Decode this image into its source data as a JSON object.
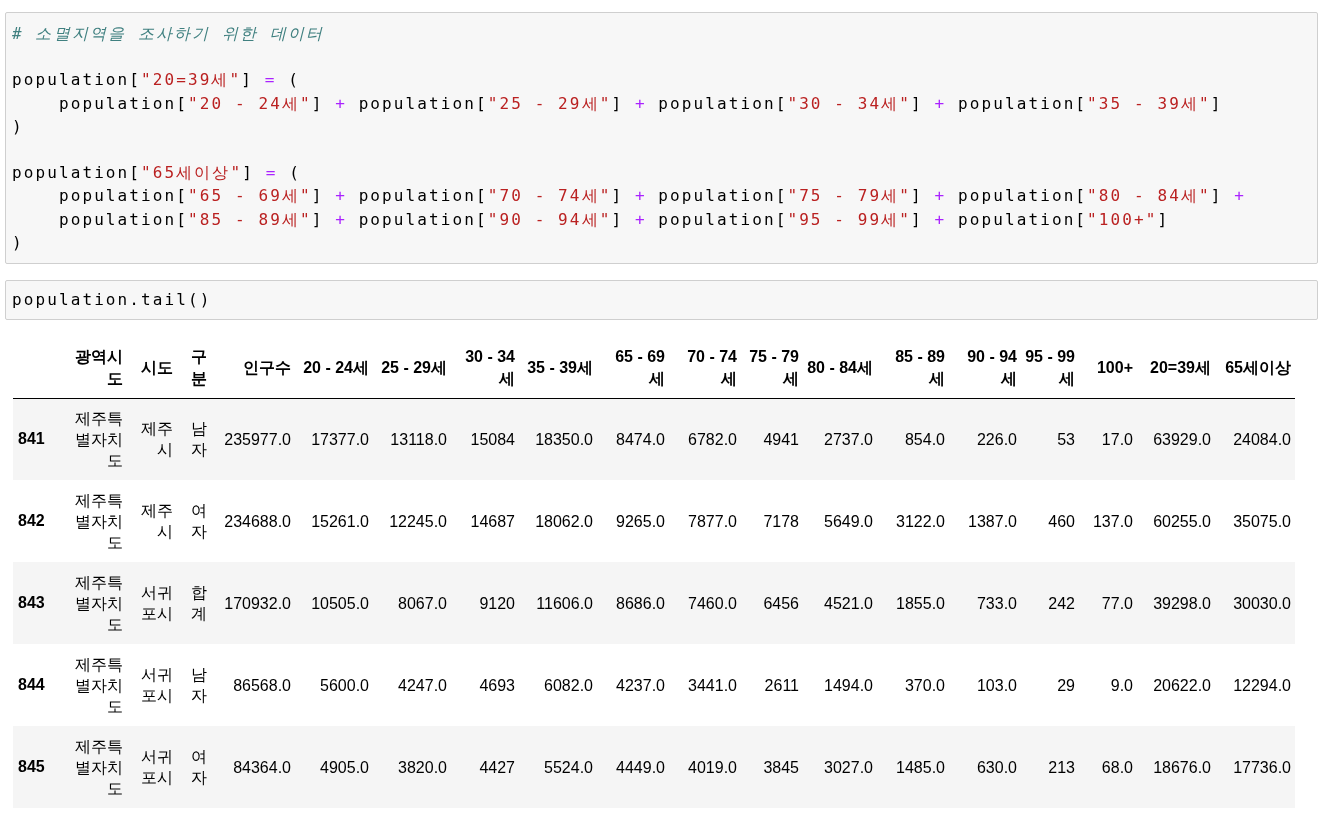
{
  "code_cells": [
    {
      "blocks": [
        [
          [
            {
              "kind": "comment",
              "text": "# 소멸지역을 조사하기 위한 데이터"
            }
          ]
        ],
        [
          [
            {
              "kind": "plain",
              "text": "population["
            },
            {
              "kind": "string",
              "text": "\"20=39세\""
            },
            {
              "kind": "plain",
              "text": "] "
            },
            {
              "kind": "op",
              "text": "="
            },
            {
              "kind": "plain",
              "text": " ("
            }
          ],
          [
            {
              "kind": "plain",
              "text": "    population["
            },
            {
              "kind": "string",
              "text": "\"20 - 24세\""
            },
            {
              "kind": "plain",
              "text": "] "
            },
            {
              "kind": "op",
              "text": "+"
            },
            {
              "kind": "plain",
              "text": " population["
            },
            {
              "kind": "string",
              "text": "\"25 - 29세\""
            },
            {
              "kind": "plain",
              "text": "] "
            },
            {
              "kind": "op",
              "text": "+"
            },
            {
              "kind": "plain",
              "text": " population["
            },
            {
              "kind": "string",
              "text": "\"30 - 34세\""
            },
            {
              "kind": "plain",
              "text": "] "
            },
            {
              "kind": "op",
              "text": "+"
            },
            {
              "kind": "plain",
              "text": " population["
            },
            {
              "kind": "string",
              "text": "\"35 - 39세\""
            },
            {
              "kind": "plain",
              "text": "]"
            }
          ],
          [
            {
              "kind": "plain",
              "text": ")"
            }
          ]
        ],
        [
          [
            {
              "kind": "plain",
              "text": "population["
            },
            {
              "kind": "string",
              "text": "\"65세이상\""
            },
            {
              "kind": "plain",
              "text": "] "
            },
            {
              "kind": "op",
              "text": "="
            },
            {
              "kind": "plain",
              "text": " ("
            }
          ],
          [
            {
              "kind": "plain",
              "text": "    population["
            },
            {
              "kind": "string",
              "text": "\"65 - 69세\""
            },
            {
              "kind": "plain",
              "text": "] "
            },
            {
              "kind": "op",
              "text": "+"
            },
            {
              "kind": "plain",
              "text": " population["
            },
            {
              "kind": "string",
              "text": "\"70 - 74세\""
            },
            {
              "kind": "plain",
              "text": "] "
            },
            {
              "kind": "op",
              "text": "+"
            },
            {
              "kind": "plain",
              "text": " population["
            },
            {
              "kind": "string",
              "text": "\"75 - 79세\""
            },
            {
              "kind": "plain",
              "text": "] "
            },
            {
              "kind": "op",
              "text": "+"
            },
            {
              "kind": "plain",
              "text": " population["
            },
            {
              "kind": "string",
              "text": "\"80 - 84세\""
            },
            {
              "kind": "plain",
              "text": "] "
            },
            {
              "kind": "op",
              "text": "+"
            }
          ],
          [
            {
              "kind": "plain",
              "text": "    population["
            },
            {
              "kind": "string",
              "text": "\"85 - 89세\""
            },
            {
              "kind": "plain",
              "text": "] "
            },
            {
              "kind": "op",
              "text": "+"
            },
            {
              "kind": "plain",
              "text": " population["
            },
            {
              "kind": "string",
              "text": "\"90 - 94세\""
            },
            {
              "kind": "plain",
              "text": "] "
            },
            {
              "kind": "op",
              "text": "+"
            },
            {
              "kind": "plain",
              "text": " population["
            },
            {
              "kind": "string",
              "text": "\"95 - 99세\""
            },
            {
              "kind": "plain",
              "text": "] "
            },
            {
              "kind": "op",
              "text": "+"
            },
            {
              "kind": "plain",
              "text": " population["
            },
            {
              "kind": "string",
              "text": "\"100+\""
            },
            {
              "kind": "plain",
              "text": "]"
            }
          ],
          [
            {
              "kind": "plain",
              "text": ")"
            }
          ]
        ]
      ]
    },
    {
      "blocks": [
        [
          [
            {
              "kind": "plain",
              "text": "population.tail()"
            }
          ]
        ]
      ]
    }
  ],
  "table": {
    "columns": [
      "광역시도",
      "시도",
      "구분",
      "인구수",
      "20 - 24세",
      "25 - 29세",
      "30 - 34세",
      "35 - 39세",
      "65 - 69세",
      "70 - 74세",
      "75 - 79세",
      "80 - 84세",
      "85 - 89세",
      "90 - 94세",
      "95 - 99세",
      "100+",
      "20=39세",
      "65세이상"
    ],
    "rows": [
      {
        "index": "841",
        "cells": [
          "제주특별자치도",
          "제주시",
          "남자",
          "235977.0",
          "17377.0",
          "13118.0",
          "15084",
          "18350.0",
          "8474.0",
          "6782.0",
          "4941",
          "2737.0",
          "854.0",
          "226.0",
          "53",
          "17.0",
          "63929.0",
          "24084.0"
        ]
      },
      {
        "index": "842",
        "cells": [
          "제주특별자치도",
          "제주시",
          "여자",
          "234688.0",
          "15261.0",
          "12245.0",
          "14687",
          "18062.0",
          "9265.0",
          "7877.0",
          "7178",
          "5649.0",
          "3122.0",
          "1387.0",
          "460",
          "137.0",
          "60255.0",
          "35075.0"
        ]
      },
      {
        "index": "843",
        "cells": [
          "제주특별자치도",
          "서귀포시",
          "합계",
          "170932.0",
          "10505.0",
          "8067.0",
          "9120",
          "11606.0",
          "8686.0",
          "7460.0",
          "6456",
          "4521.0",
          "1855.0",
          "733.0",
          "242",
          "77.0",
          "39298.0",
          "30030.0"
        ]
      },
      {
        "index": "844",
        "cells": [
          "제주특별자치도",
          "서귀포시",
          "남자",
          "86568.0",
          "5600.0",
          "4247.0",
          "4693",
          "6082.0",
          "4237.0",
          "3441.0",
          "2611",
          "1494.0",
          "370.0",
          "103.0",
          "29",
          "9.0",
          "20622.0",
          "12294.0"
        ]
      },
      {
        "index": "845",
        "cells": [
          "제주특별자치도",
          "서귀포시",
          "여자",
          "84364.0",
          "4905.0",
          "3820.0",
          "4427",
          "5524.0",
          "4449.0",
          "4019.0",
          "3845",
          "3027.0",
          "1485.0",
          "630.0",
          "213",
          "68.0",
          "18676.0",
          "17736.0"
        ]
      }
    ]
  }
}
